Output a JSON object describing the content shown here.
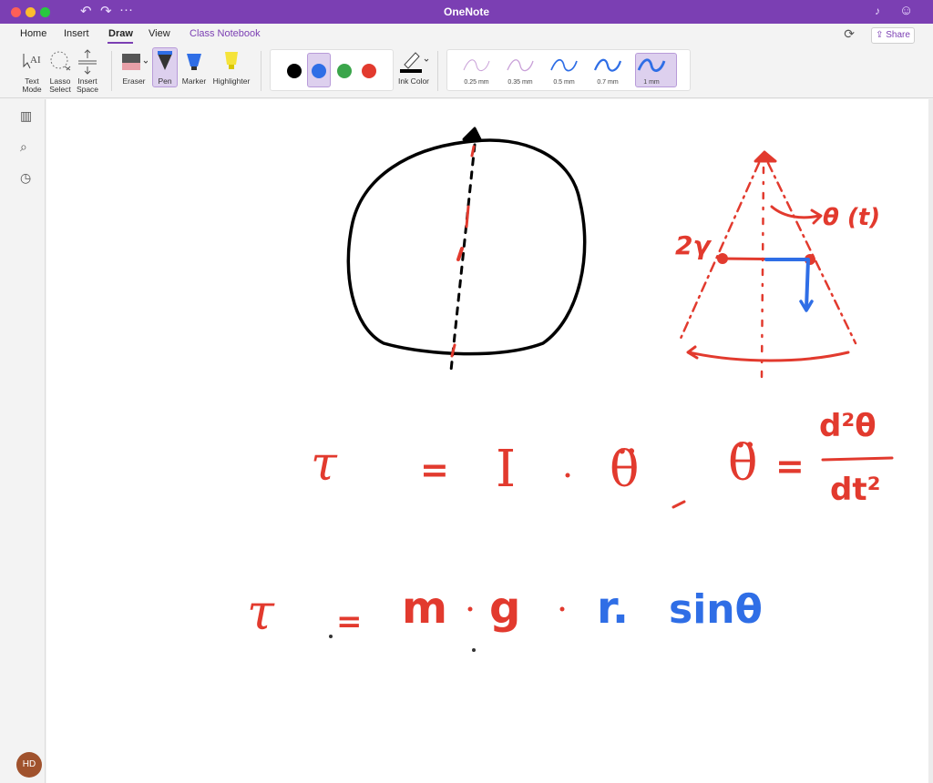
{
  "window": {
    "title": "OneNote"
  },
  "menubar": {
    "tabs": [
      "Home",
      "Insert",
      "Draw",
      "View",
      "Class Notebook"
    ],
    "share_label": "Share"
  },
  "ribbon": {
    "tools": {
      "text_mode": "Text Mode",
      "lasso_select": "Lasso Select",
      "insert_space": "Insert Space",
      "eraser": "Eraser",
      "pen": "Pen",
      "marker": "Marker",
      "highlighter": "Highlighter",
      "ink_color": "Ink Color"
    },
    "pen_colors": [
      "#000000",
      "#2f6ee6",
      "#3aa54a",
      "#e23a2e"
    ],
    "selected_color": "#2f6ee6",
    "thicknesses": [
      "0.25 mm",
      "0.35 mm",
      "0.5 mm",
      "0.7 mm",
      "1 mm"
    ],
    "selected_thickness": "1 mm"
  },
  "sidebar": {
    "icons": [
      "notebooks-icon",
      "search-icon",
      "recent-icon"
    ],
    "avatar_initials": "HD"
  },
  "colors": {
    "accent": "#7b3fb3",
    "ink_red": "#e23a2e",
    "ink_blue": "#2f6ee6",
    "ink_black": "#000000"
  }
}
